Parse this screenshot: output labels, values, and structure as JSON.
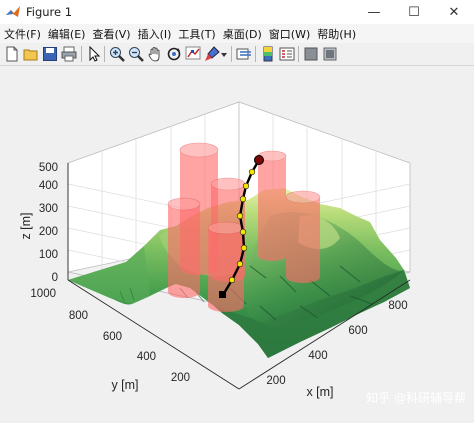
{
  "window": {
    "title": "Figure 1",
    "minimize": "—",
    "maximize": "☐",
    "close": "✕"
  },
  "menu": [
    "文件(F)",
    "编辑(E)",
    "查看(V)",
    "插入(I)",
    "工具(T)",
    "桌面(D)",
    "窗口(W)",
    "帮助(H)"
  ],
  "toolbar_icons": [
    "new-figure-icon",
    "open-file-icon",
    "save-icon",
    "print-icon",
    "edit-plot-arrow-icon",
    "zoom-in-icon",
    "zoom-out-icon",
    "pan-hand-icon",
    "rotate-3d-icon",
    "data-cursor-icon",
    "brush-icon",
    "brush-dropdown-icon",
    "link-plot-icon",
    "insert-colorbar-icon",
    "insert-legend-icon",
    "hide-plot-tools-icon",
    "show-plot-tools-icon"
  ],
  "chart_data": {
    "type": "surface-3d",
    "xlabel": "x [m]",
    "ylabel": "y [m]",
    "zlabel": "z [m]",
    "x_ticks": [
      "200",
      "400",
      "600",
      "800"
    ],
    "y_ticks": [
      "200",
      "400",
      "600",
      "800",
      "1000"
    ],
    "z_ticks": [
      "0",
      "100",
      "200",
      "300",
      "400",
      "500"
    ],
    "xlim": [
      0,
      1000
    ],
    "ylim": [
      0,
      1000
    ],
    "zlim": [
      0,
      500
    ],
    "surface_colormap": [
      "#1d6b3a",
      "#3e9a4a",
      "#7fc062",
      "#b8dc7a",
      "#e8f0a8"
    ],
    "obstacles_color": "#ff5a5a",
    "obstacles": [
      {
        "x": 300,
        "y": 700,
        "r": 60,
        "h": 500
      },
      {
        "x": 450,
        "y": 750,
        "r": 55,
        "h": 400
      },
      {
        "x": 650,
        "y": 720,
        "r": 55,
        "h": 400
      },
      {
        "x": 250,
        "y": 500,
        "r": 55,
        "h": 350
      },
      {
        "x": 500,
        "y": 450,
        "r": 55,
        "h": 300
      },
      {
        "x": 800,
        "y": 600,
        "r": 55,
        "h": 300
      }
    ],
    "path": {
      "start_marker": "square",
      "end_marker": "circle",
      "line_color": "#000000",
      "waypoint_color": "#f5e400"
    }
  },
  "watermark": "知乎 @科研辅导帮"
}
